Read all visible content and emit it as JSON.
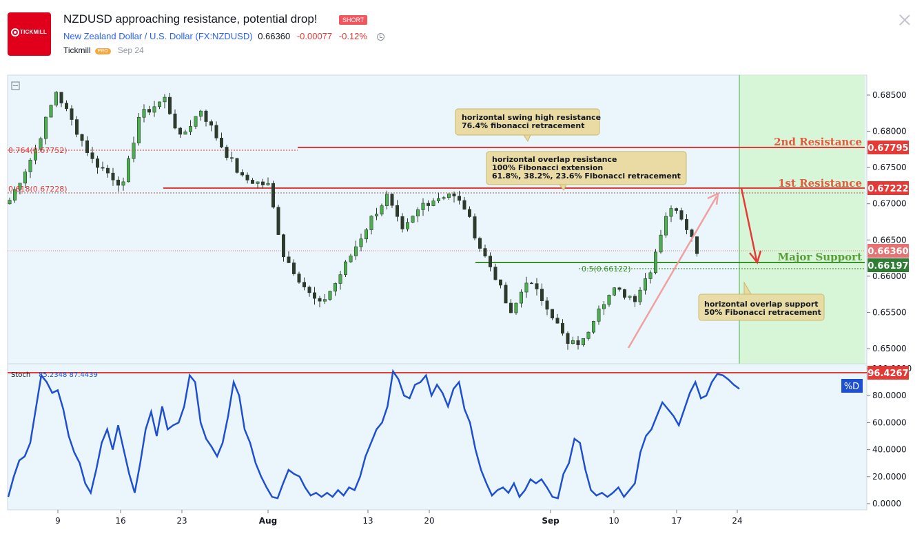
{
  "header": {
    "logo_text": "TICKMILL",
    "title": "NZDUSD approaching resistance, potential drop!",
    "badge": "SHORT",
    "symbol_name": "New Zealand Dollar / U.S. Dollar",
    "symbol_ticker": "FX:NZDUSD",
    "price": "0.66360",
    "change": "-0.00077",
    "change_pct": "-0.12%",
    "author": "Tickmill",
    "author_badge": "PRO",
    "date": "Sep 24",
    "colors": {
      "logo": "#e0001b",
      "link": "#2962ff",
      "negative": "#e53935"
    }
  },
  "chart_data": [
    {
      "type": "candlestick",
      "title": "",
      "y_ticks": [
        "0.68500",
        "0.68000",
        "0.67500",
        "0.67000",
        "0.66500",
        "0.66000",
        "0.65500",
        "0.65000"
      ],
      "ylim": [
        0.6478,
        0.6876
      ],
      "x_ticks": [
        "9",
        "16",
        "23",
        "Aug",
        "13",
        "20",
        "Sep",
        "10",
        "17",
        "24"
      ],
      "last_price": "0.66360",
      "series_approx": {
        "note_points": [
          [
            0,
            0.6705
          ],
          [
            5,
            0.6775
          ],
          [
            9,
            0.6855
          ],
          [
            16,
            0.676
          ],
          [
            22,
            0.6725
          ],
          [
            25,
            0.682
          ],
          [
            30,
            0.6845
          ],
          [
            33,
            0.679
          ],
          [
            37,
            0.683
          ],
          [
            41,
            0.678
          ],
          [
            45,
            0.6735
          ],
          [
            50,
            0.6725
          ],
          [
            53,
            0.663
          ],
          [
            58,
            0.6575
          ],
          [
            60,
            0.656
          ],
          [
            63,
            0.659
          ],
          [
            70,
            0.668
          ],
          [
            73,
            0.671
          ],
          [
            76,
            0.666
          ],
          [
            80,
            0.67
          ],
          [
            85,
            0.6715
          ],
          [
            88,
            0.6695
          ],
          [
            91,
            0.664
          ],
          [
            94,
            0.66
          ],
          [
            97,
            0.6545
          ],
          [
            100,
            0.6595
          ],
          [
            104,
            0.656
          ],
          [
            108,
            0.6505
          ],
          [
            111,
            0.651
          ],
          [
            114,
            0.656
          ],
          [
            117,
            0.658
          ],
          [
            121,
            0.657
          ],
          [
            124,
            0.661
          ],
          [
            127,
            0.6685
          ],
          [
            129,
            0.6695
          ],
          [
            131,
            0.667
          ],
          [
            133,
            0.6636
          ]
        ]
      },
      "levels": [
        {
          "label": "2nd Resistance",
          "price_tag": "0.67795",
          "color": "#e53935"
        },
        {
          "label": "1st Resistance",
          "price_tag": "0.67222",
          "color": "#e53935"
        },
        {
          "label": "Major Support",
          "price_tag": "0.66197",
          "color": "#3e8e2e"
        }
      ],
      "current_tag": "0.66360",
      "fib_labels": [
        "0.764(0.67752)",
        "0.618(0.67228)",
        "0.5(0.66122)"
      ],
      "annotations": [
        {
          "lines": [
            "horizontal swing high resistance",
            "76.4% fibonacci retracement"
          ]
        },
        {
          "lines": [
            "horizontal overlap resistance",
            "100% Fibonacci extension",
            "61.8%, 38.2%, 23.6% Fibonacci retracement"
          ]
        },
        {
          "lines": [
            "horizontal overlap support",
            "50% Fibonacci retracement"
          ]
        }
      ]
    },
    {
      "type": "line",
      "title": "",
      "indicator_label": "Stoch",
      "indicator_values": "85.2348  87.4439",
      "y_ticks": [
        "100.0000",
        "80.0000",
        "60.0000",
        "40.0000",
        "20.0000",
        "0.0000"
      ],
      "ylim": [
        0,
        100
      ],
      "level_tag": "96.4267",
      "series_tag": "%D",
      "series": [
        {
          "name": "%D",
          "values": [
            5,
            20,
            32,
            35,
            45,
            70,
            95,
            90,
            82,
            84,
            70,
            50,
            38,
            30,
            15,
            8,
            25,
            45,
            55,
            40,
            58,
            40,
            22,
            8,
            30,
            55,
            68,
            50,
            72,
            55,
            58,
            60,
            72,
            95,
            90,
            60,
            48,
            42,
            35,
            45,
            65,
            90,
            80,
            55,
            45,
            30,
            20,
            12,
            5,
            4,
            15,
            25,
            22,
            20,
            12,
            6,
            8,
            5,
            8,
            5,
            10,
            6,
            12,
            10,
            20,
            35,
            45,
            55,
            60,
            72,
            98,
            92,
            80,
            78,
            88,
            90,
            95,
            80,
            88,
            82,
            72,
            85,
            90,
            70,
            60,
            40,
            25,
            15,
            6,
            10,
            12,
            8,
            15,
            5,
            10,
            18,
            15,
            18,
            12,
            5,
            4,
            22,
            30,
            48,
            45,
            25,
            10,
            6,
            8,
            5,
            8,
            12,
            5,
            10,
            15,
            38,
            50,
            55,
            65,
            75,
            70,
            65,
            58,
            70,
            82,
            90,
            78,
            80,
            90,
            96,
            95,
            92,
            88,
            85
          ]
        }
      ]
    }
  ]
}
